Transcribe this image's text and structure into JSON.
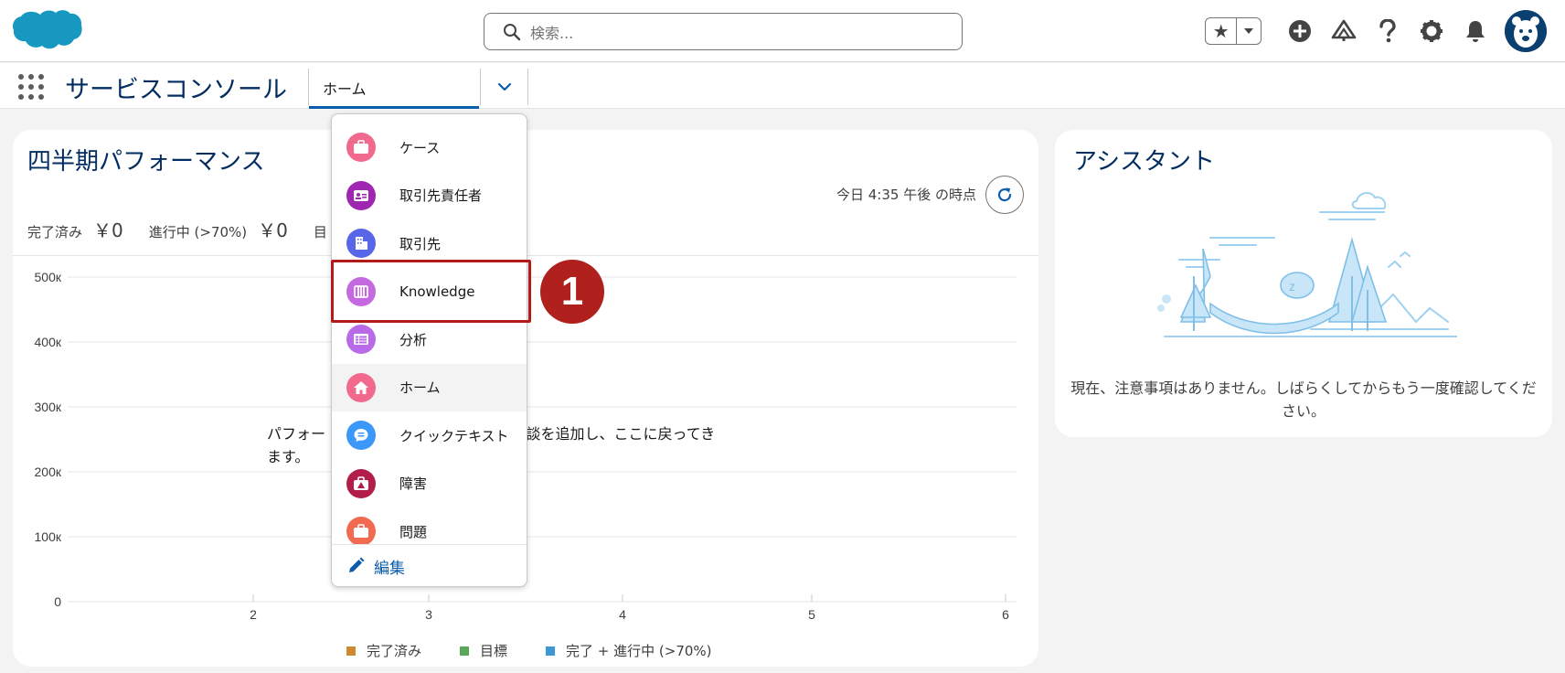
{
  "header": {
    "search_placeholder": "検索...",
    "icons": [
      "star-icon",
      "chevron-down-icon",
      "add-icon",
      "trailhead-icon",
      "help-icon",
      "gear-icon",
      "bell-icon",
      "avatar"
    ]
  },
  "app_nav": {
    "app_name": "サービスコンソール",
    "current_tab": "ホーム"
  },
  "performance": {
    "title": "四半期パフォーマンス",
    "as_of": "今日 4:35 午後 の時点",
    "metrics": [
      {
        "label": "完了済み",
        "value": "￥0"
      },
      {
        "label": "進行中 (>70%)",
        "value": "￥0"
      },
      {
        "label": "目"
      }
    ],
    "message_line1": "パフォー",
    "message_line1_rest": "達している商談を追加し、ここに戻ってき",
    "message_line2": "ます。",
    "legend": [
      "完了済み",
      "目標",
      "完了 + 進行中 (>70%)"
    ]
  },
  "chart_data": {
    "type": "line",
    "x_ticks": [
      "2",
      "3",
      "4",
      "5",
      "6"
    ],
    "y_ticks": [
      "0",
      "100к",
      "200к",
      "300к",
      "400к",
      "500к"
    ],
    "ylim": [
      0,
      500000
    ],
    "series": [
      {
        "name": "完了済み",
        "color": "#d08a30",
        "values": []
      },
      {
        "name": "目標",
        "color": "#5aa65b",
        "values": []
      },
      {
        "name": "完了 + 進行中 (>70%)",
        "color": "#3b97d8",
        "values": []
      }
    ]
  },
  "assistant": {
    "title": "アシスタント",
    "message": "現在、注意事項はありません。しばらくしてからもう一度確認してください。"
  },
  "dropdown": {
    "items": [
      {
        "label": "ケース",
        "icon": "case-icon",
        "color": "#f2698e"
      },
      {
        "label": "取引先責任者",
        "icon": "contact-icon",
        "color": "#9e26b0"
      },
      {
        "label": "取引先",
        "icon": "account-icon",
        "color": "#5867e8"
      },
      {
        "label": "Knowledge",
        "icon": "knowledge-icon",
        "color": "#c569e0"
      },
      {
        "label": "分析",
        "icon": "analytics-icon",
        "color": "#b86ae8"
      },
      {
        "label": "ホーム",
        "icon": "home-icon",
        "color": "#f2698e"
      },
      {
        "label": "クイックテキスト",
        "icon": "quick-text-icon",
        "color": "#3b97f8"
      },
      {
        "label": "障害",
        "icon": "incident-icon",
        "color": "#b21d4a"
      },
      {
        "label": "問題",
        "icon": "problem-icon",
        "color": "#f26b50"
      }
    ],
    "edit_label": "編集"
  },
  "callout": {
    "step_number": "1"
  }
}
